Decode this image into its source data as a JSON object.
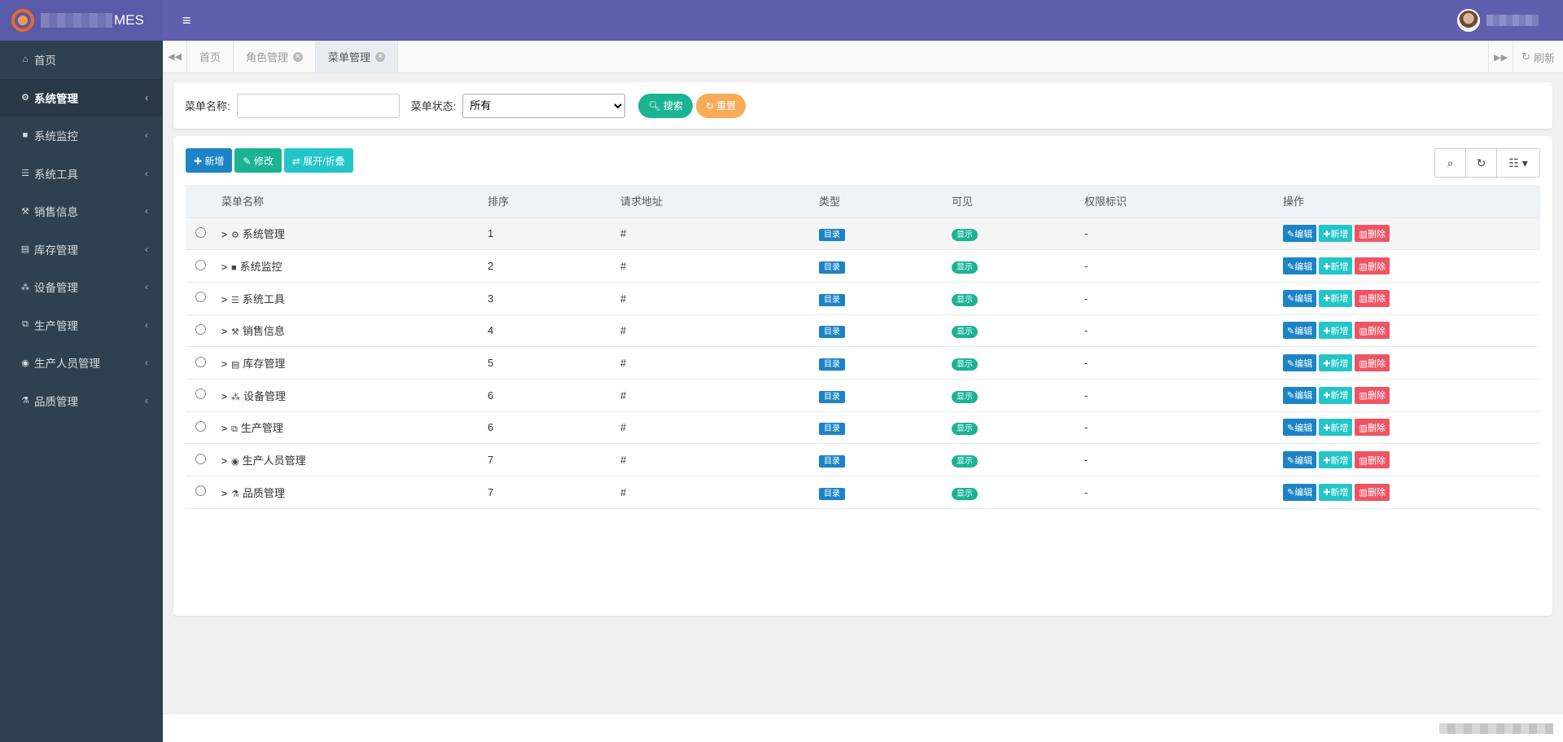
{
  "app": {
    "title_suffix": "MES"
  },
  "header": {
    "menu_icon": "hamburger-icon"
  },
  "sidebar": {
    "items": [
      {
        "icon": "home-icon",
        "glyph": "⌂",
        "label": "首页",
        "has_arrow": false,
        "active": false
      },
      {
        "icon": "gear-icon",
        "glyph": "⚙",
        "label": "系统管理",
        "has_arrow": true,
        "active": true
      },
      {
        "icon": "video-icon",
        "glyph": "■",
        "label": "系统监控",
        "has_arrow": true,
        "active": false
      },
      {
        "icon": "list-icon",
        "glyph": "☰",
        "label": "系统工具",
        "has_arrow": true,
        "active": false
      },
      {
        "icon": "gavel-icon",
        "glyph": "⚒",
        "label": "销售信息",
        "has_arrow": true,
        "active": false
      },
      {
        "icon": "archive-icon",
        "glyph": "▤",
        "label": "库存管理",
        "has_arrow": true,
        "active": false
      },
      {
        "icon": "cubes-icon",
        "glyph": "⁂",
        "label": "设备管理",
        "has_arrow": true,
        "active": false
      },
      {
        "icon": "clone-icon",
        "glyph": "⧉",
        "label": "生产管理",
        "has_arrow": true,
        "active": false
      },
      {
        "icon": "user-circle-icon",
        "glyph": "◉",
        "label": "生产人员管理",
        "has_arrow": true,
        "active": false
      },
      {
        "icon": "flask-icon",
        "glyph": "⚗",
        "label": "品质管理",
        "has_arrow": true,
        "active": false
      }
    ]
  },
  "tabs": [
    {
      "label": "首页",
      "closable": false,
      "active": false
    },
    {
      "label": "角色管理",
      "closable": true,
      "active": false
    },
    {
      "label": "菜单管理",
      "closable": true,
      "active": true
    }
  ],
  "tabbar": {
    "refresh_label": "刷新"
  },
  "search": {
    "name_label": "菜单名称:",
    "name_value": "",
    "status_label": "菜单状态:",
    "status_value": "所有",
    "search_button": "搜索",
    "reset_button": "重置"
  },
  "toolbar": {
    "add_label": "新增",
    "edit_label": "修改",
    "toggle_label": "展开/折叠"
  },
  "table": {
    "columns": [
      "菜单名称",
      "排序",
      "请求地址",
      "类型",
      "可见",
      "权限标识",
      "操作"
    ],
    "type_badge": "目录",
    "visible_badge": "显示",
    "op_edit": "编辑",
    "op_add": "新增",
    "op_delete": "删除",
    "rows": [
      {
        "icon": "gear-icon",
        "glyph": "⚙",
        "name": "系统管理",
        "order": "1",
        "url": "#",
        "perm": "-"
      },
      {
        "icon": "video-icon",
        "glyph": "■",
        "name": "系统监控",
        "order": "2",
        "url": "#",
        "perm": "-"
      },
      {
        "icon": "list-icon",
        "glyph": "☰",
        "name": "系统工具",
        "order": "3",
        "url": "#",
        "perm": "-"
      },
      {
        "icon": "gavel-icon",
        "glyph": "⚒",
        "name": "销售信息",
        "order": "4",
        "url": "#",
        "perm": "-"
      },
      {
        "icon": "archive-icon",
        "glyph": "▤",
        "name": "库存管理",
        "order": "5",
        "url": "#",
        "perm": "-"
      },
      {
        "icon": "cubes-icon",
        "glyph": "⁂",
        "name": "设备管理",
        "order": "6",
        "url": "#",
        "perm": "-"
      },
      {
        "icon": "clone-icon",
        "glyph": "⧉",
        "name": "生产管理",
        "order": "6",
        "url": "#",
        "perm": "-"
      },
      {
        "icon": "user-circle-icon",
        "glyph": "◉",
        "name": "生产人员管理",
        "order": "7",
        "url": "#",
        "perm": "-"
      },
      {
        "icon": "flask-icon",
        "glyph": "⚗",
        "name": "品质管理",
        "order": "7",
        "url": "#",
        "perm": "-"
      }
    ]
  },
  "colors": {
    "sidebar_bg": "#2f4050",
    "header_bg": "#5f5fad",
    "primary": "#1c84c6",
    "success": "#1ab394",
    "info": "#23c6c8",
    "warning": "#f8ac59",
    "danger": "#ed5565"
  }
}
